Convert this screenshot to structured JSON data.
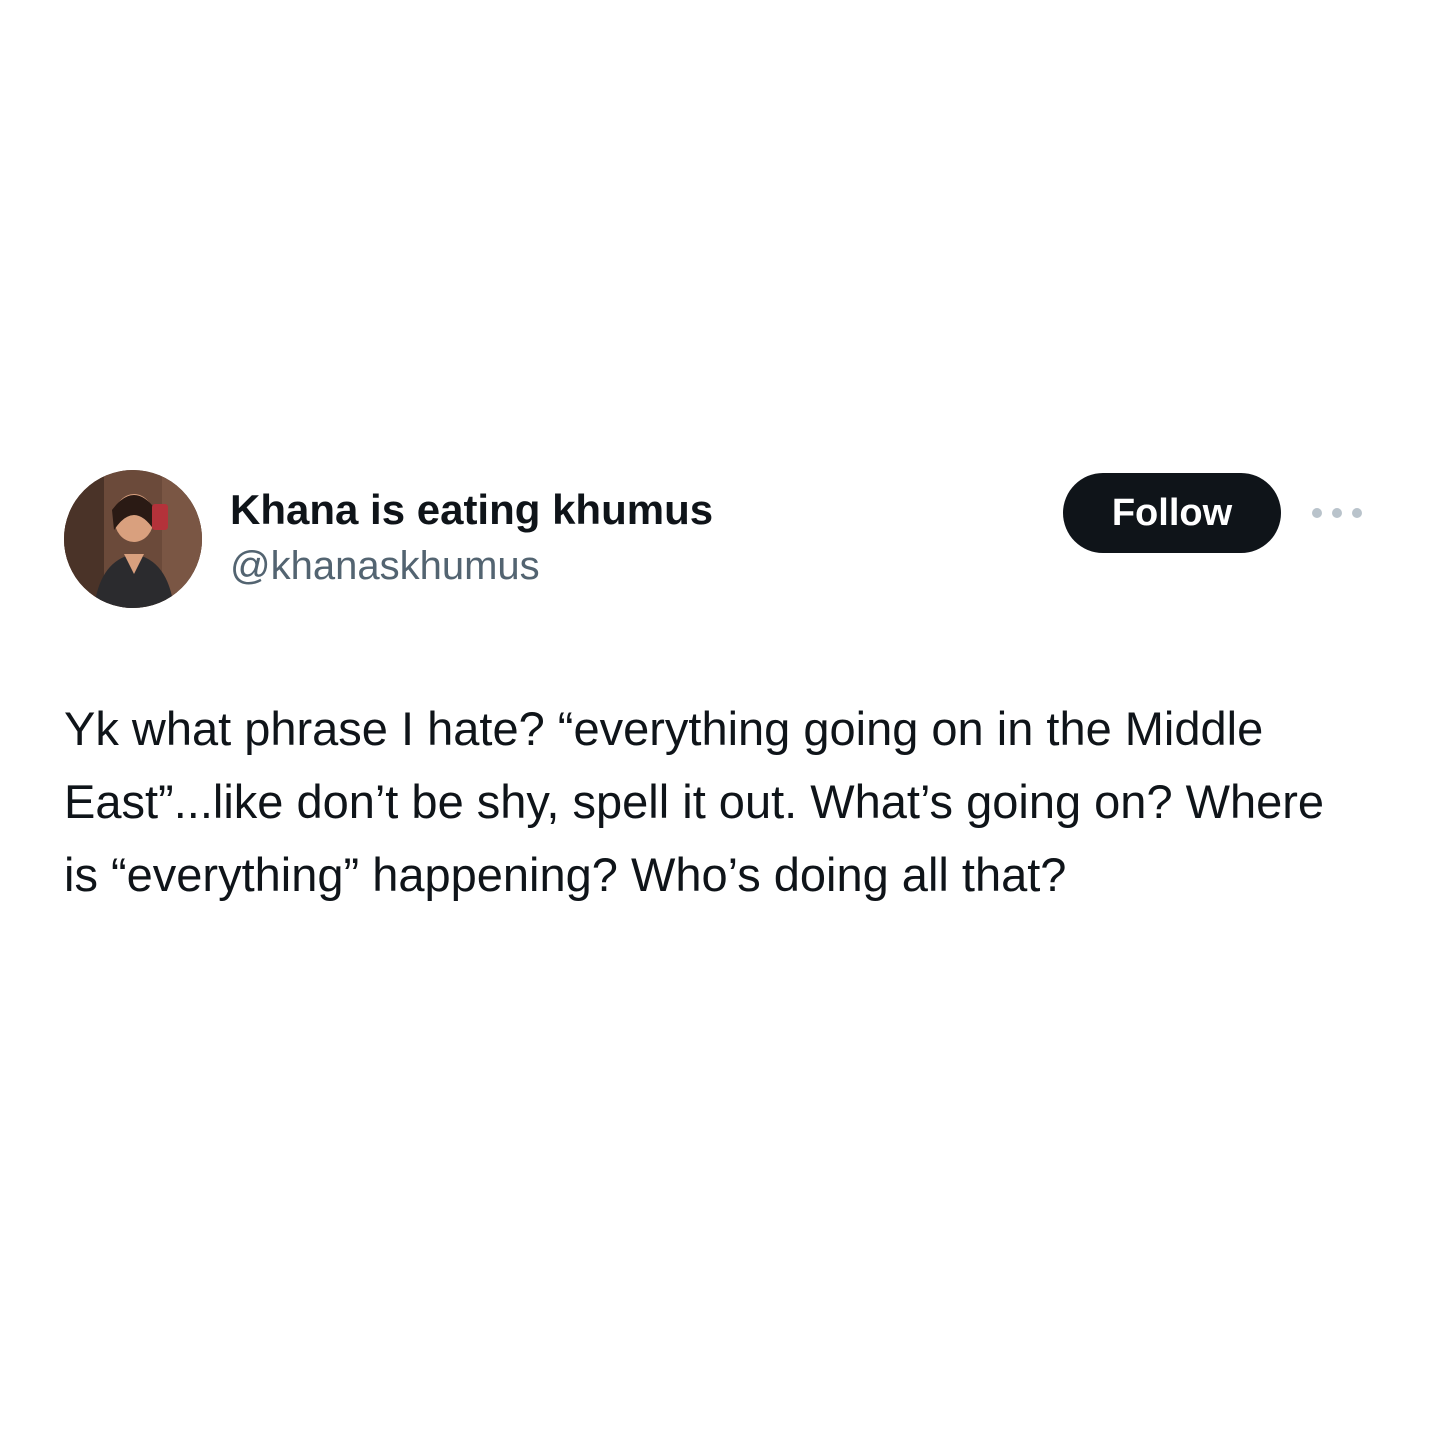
{
  "tweet": {
    "author": {
      "display_name": "Khana is eating khumus",
      "handle": "@khanaskhumus",
      "avatar_icon": "profile-photo"
    },
    "follow_label": "Follow",
    "more_icon": "more-options-icon",
    "text": "Yk what phrase I hate? “everything going on in the Middle East”...like don’t be shy, spell it out. What’s going on? Where is “everything” happening? Who’s doing all that?"
  },
  "colors": {
    "text_primary": "#0f1419",
    "text_secondary": "#536471",
    "button_bg": "#0f1419",
    "button_text": "#ffffff",
    "background": "#ffffff"
  }
}
